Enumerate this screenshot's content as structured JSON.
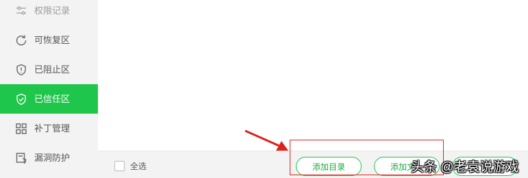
{
  "sidebar": {
    "items": [
      {
        "label": "权限记录",
        "icon": "sliders-icon",
        "state": "faded"
      },
      {
        "label": "可恢复区",
        "icon": "refresh-icon",
        "state": "normal"
      },
      {
        "label": "已阻止区",
        "icon": "shield-exclamation-icon",
        "state": "normal"
      },
      {
        "label": "已信任区",
        "icon": "shield-check-icon",
        "state": "active"
      },
      {
        "label": "补丁管理",
        "icon": "grid-icon",
        "state": "normal"
      },
      {
        "label": "漏洞防护",
        "icon": "document-shield-icon",
        "state": "normal"
      }
    ]
  },
  "footer": {
    "select_all_label": "全选",
    "add_directory_label": "添加目录",
    "add_file_label": "添加文",
    "third_button_label": ""
  },
  "watermark": "头条 @老袁说游戏",
  "colors": {
    "accent": "#1fc64c",
    "sidebar_bg": "#f3f3f3",
    "annotation_red": "#e0201a"
  }
}
